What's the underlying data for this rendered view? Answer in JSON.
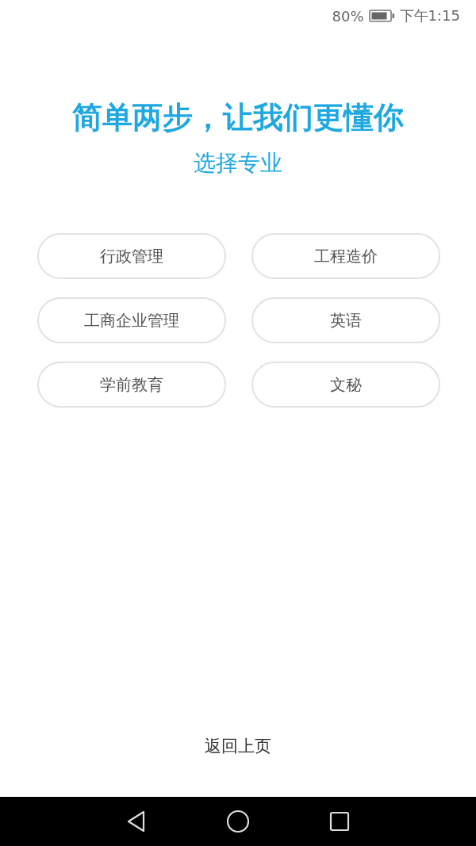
{
  "status_bar": {
    "battery_text": "80%",
    "time": "下午1:15"
  },
  "title": "简单两步，让我们更懂你",
  "subtitle": "选择专业",
  "majors": [
    {
      "label": "行政管理",
      "selected": false
    },
    {
      "label": "工程造价",
      "selected": false
    },
    {
      "label": "工商企业管理",
      "selected": false
    },
    {
      "label": "英语",
      "selected": false
    },
    {
      "label": "学前教育",
      "selected": false
    },
    {
      "label": "文秘",
      "selected": false
    }
  ],
  "back_link": "返回上页"
}
